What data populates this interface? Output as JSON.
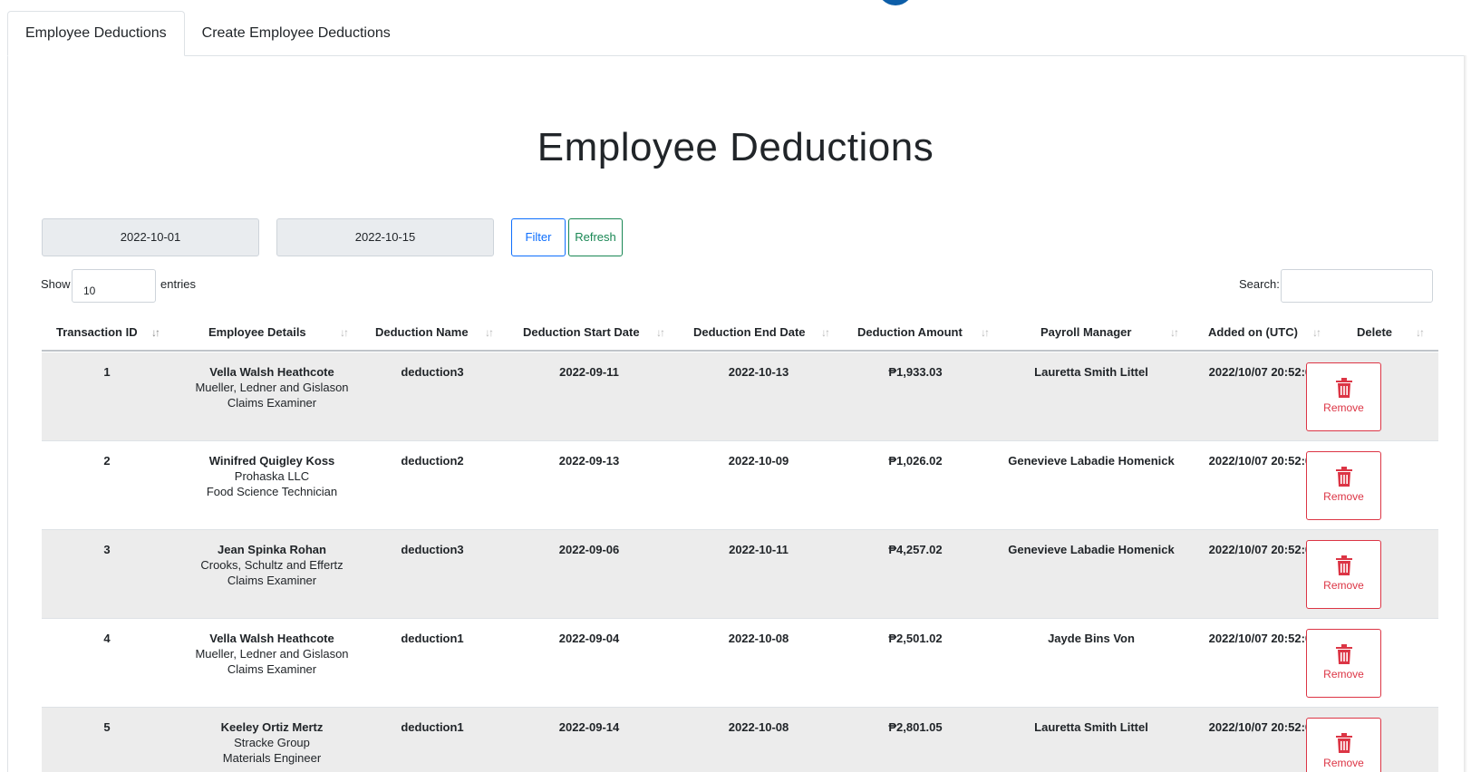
{
  "tabs": [
    "Employee Deductions",
    "Create Employee Deductions"
  ],
  "page_title": "Employee Deductions",
  "filters": {
    "start_date": "2022-10-01",
    "end_date": "2022-10-15",
    "filter_label": "Filter",
    "refresh_label": "Refresh"
  },
  "table_controls": {
    "show_label": "Show",
    "entries_value": "10",
    "entries_label": "entries",
    "search_label": "Search:"
  },
  "columns": [
    "Transaction ID",
    "Employee Details",
    "Deduction Name",
    "Deduction Start Date",
    "Deduction End Date",
    "Deduction Amount",
    "Payroll Manager",
    "Added on (UTC)",
    "Delete"
  ],
  "rows": [
    {
      "id": "1",
      "name": "Vella Walsh Heathcote",
      "company": "Mueller, Ledner and Gislason",
      "position": "Claims Examiner",
      "deduction": "deduction3",
      "start": "2022-09-11",
      "end": "2022-10-13",
      "amount": "₱1,933.03",
      "manager": "Lauretta Smith Littel",
      "added": "2022/10/07 20:52:02",
      "action": "Remove"
    },
    {
      "id": "2",
      "name": "Winifred Quigley Koss",
      "company": "Prohaska LLC",
      "position": "Food Science Technician",
      "deduction": "deduction2",
      "start": "2022-09-13",
      "end": "2022-10-09",
      "amount": "₱1,026.02",
      "manager": "Genevieve Labadie Homenick",
      "added": "2022/10/07 20:52:02",
      "action": "Remove"
    },
    {
      "id": "3",
      "name": "Jean Spinka Rohan",
      "company": "Crooks, Schultz and Effertz",
      "position": "Claims Examiner",
      "deduction": "deduction3",
      "start": "2022-09-06",
      "end": "2022-10-11",
      "amount": "₱4,257.02",
      "manager": "Genevieve Labadie Homenick",
      "added": "2022/10/07 20:52:01",
      "action": "Remove"
    },
    {
      "id": "4",
      "name": "Vella Walsh Heathcote",
      "company": "Mueller, Ledner and Gislason",
      "position": "Claims Examiner",
      "deduction": "deduction1",
      "start": "2022-09-04",
      "end": "2022-10-08",
      "amount": "₱2,501.02",
      "manager": "Jayde Bins Von",
      "added": "2022/10/07 20:52:02",
      "action": "Remove"
    },
    {
      "id": "5",
      "name": "Keeley Ortiz Mertz",
      "company": "Stracke Group",
      "position": "Materials Engineer",
      "deduction": "deduction1",
      "start": "2022-09-14",
      "end": "2022-10-08",
      "amount": "₱2,801.05",
      "manager": "Lauretta Smith Littel",
      "added": "2022/10/07 20:52:02",
      "action": "Remove"
    }
  ]
}
